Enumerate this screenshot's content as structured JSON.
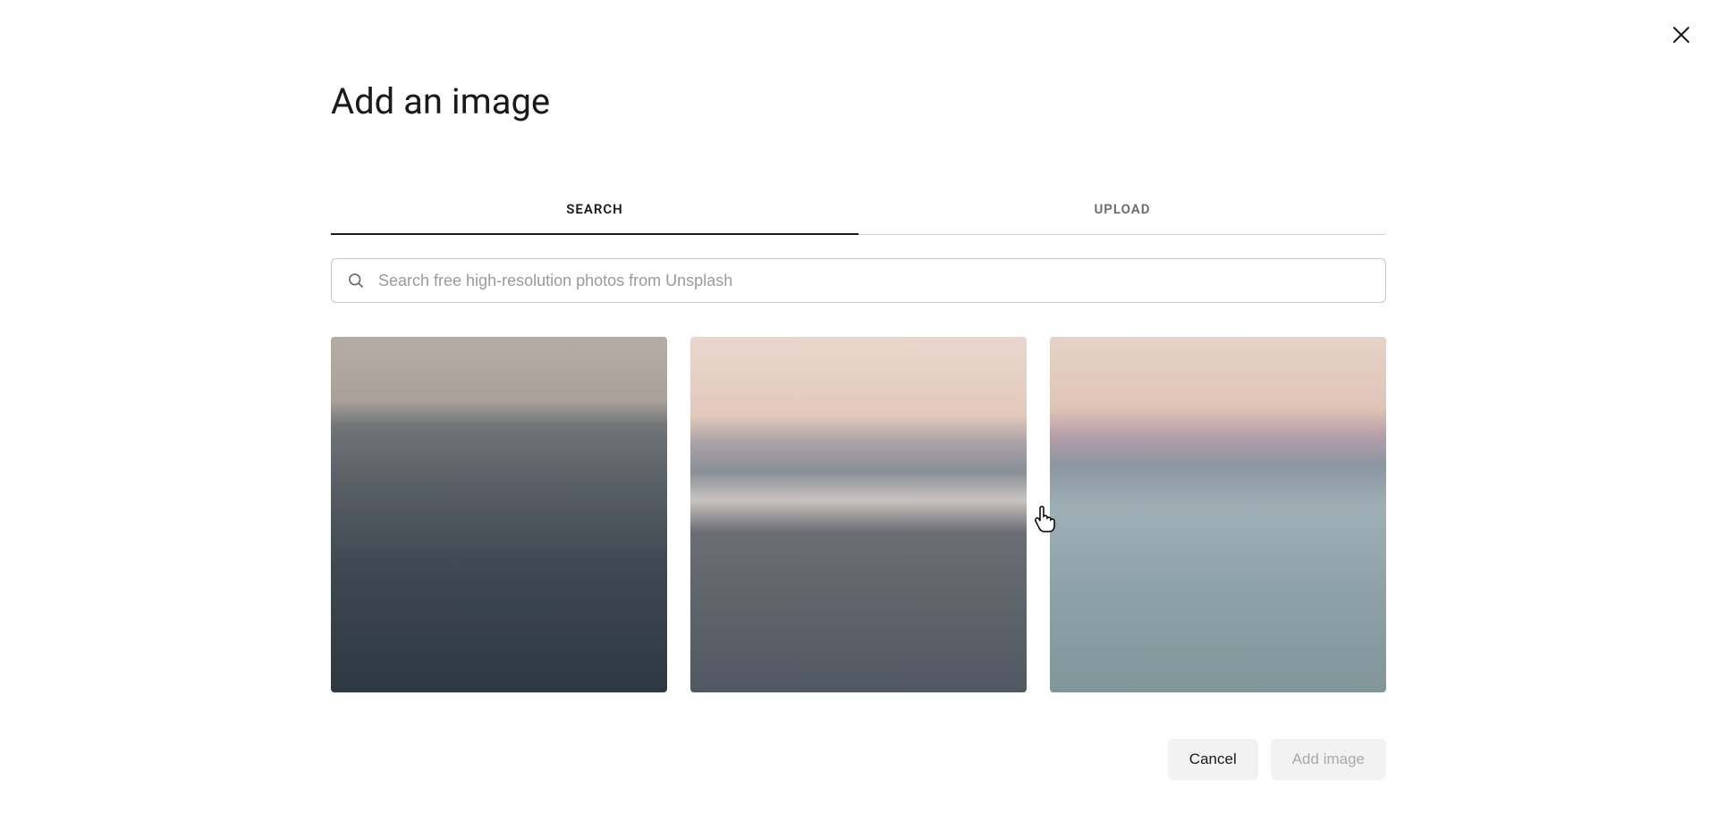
{
  "modal": {
    "title": "Add an image"
  },
  "tabs": {
    "search_label": "SEARCH",
    "upload_label": "UPLOAD"
  },
  "search": {
    "placeholder": "Search free high-resolution photos from Unsplash",
    "value": ""
  },
  "images": [
    {
      "alt": "ocean-water-close-up"
    },
    {
      "alt": "ocean-waves-sunset"
    },
    {
      "alt": "ocean-horizon-blur"
    }
  ],
  "actions": {
    "cancel_label": "Cancel",
    "add_label": "Add image"
  },
  "colors": {
    "text_primary": "#1a1a1a",
    "text_secondary": "#6b6b6b",
    "text_disabled": "#aaaaaa",
    "border": "#c7c7c7",
    "button_bg": "#f2f2f2"
  }
}
